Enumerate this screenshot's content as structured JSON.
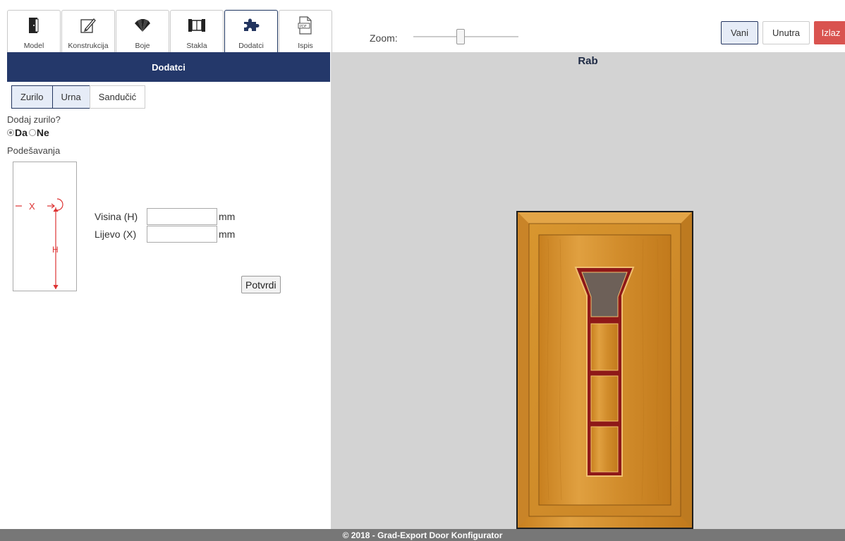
{
  "tabs": [
    {
      "label": "Model",
      "icon": "door-icon"
    },
    {
      "label": "Konstrukcija",
      "icon": "pencil-icon"
    },
    {
      "label": "Boje",
      "icon": "palette-fan-icon"
    },
    {
      "label": "Stakla",
      "icon": "glass-panel-icon"
    },
    {
      "label": "Dodatci",
      "icon": "puzzle-icon",
      "active": true
    },
    {
      "label": "Ispis",
      "icon": "pdf-icon"
    }
  ],
  "section_header": "Dodatci",
  "subtabs": [
    {
      "label": "Zurilo",
      "selected": true
    },
    {
      "label": "Urna",
      "selected": true
    },
    {
      "label": "Sandučić",
      "selected": false
    }
  ],
  "question": "Dodaj zurilo?",
  "radio": {
    "yes_label": "Da",
    "no_label": "Ne",
    "selected": "Da"
  },
  "settings_label": "Podešavanja",
  "diagram": {
    "x_label": "X",
    "h_label": "H"
  },
  "fields": {
    "height_label": "Visina (H)",
    "height_value": "",
    "left_label": "Lijevo (X)",
    "left_value": "",
    "unit": "mm"
  },
  "confirm_label": "Potvrdi",
  "zoom": {
    "label": "Zoom:",
    "level": 0.45
  },
  "top_buttons": {
    "outside": "Vani",
    "inside": "Unutra",
    "exit": "Izlaz"
  },
  "preview_title": "Rab",
  "footer": "© 2018 - Grad-Export Door Konfigurator",
  "colors": {
    "header_bg": "#24386a",
    "exit_btn": "#d9534f",
    "preview_bg": "#d3d3d3",
    "wood": "#d9952e",
    "frame_red": "#8e1818"
  }
}
